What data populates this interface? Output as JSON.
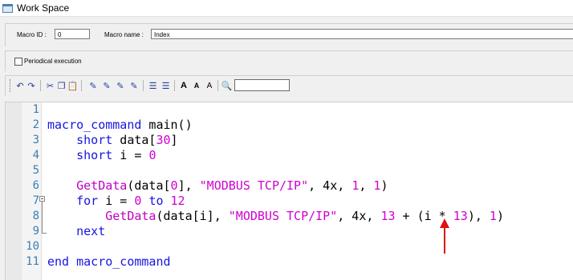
{
  "window": {
    "title": "Work Space"
  },
  "macro": {
    "id_label": "Macro ID :",
    "id_value": "0",
    "name_label": "Macro name :",
    "name_value": "Index"
  },
  "options": {
    "periodical_label": "Periodical execution",
    "periodical_checked": false
  },
  "toolbar": {
    "font_increase": "A",
    "font_decrease": "A",
    "font_normal": "A",
    "search_value": ""
  },
  "editor": {
    "lines": [
      {
        "n": "1",
        "tokens": []
      },
      {
        "n": "2",
        "tokens": [
          [
            "kw",
            "macro_command"
          ],
          [
            "pl",
            " main()"
          ]
        ]
      },
      {
        "n": "3",
        "tokens": [
          [
            "pl",
            "    "
          ],
          [
            "kw",
            "short"
          ],
          [
            "pl",
            " data["
          ],
          [
            "num",
            "30"
          ],
          [
            "pl",
            "]"
          ]
        ]
      },
      {
        "n": "4",
        "tokens": [
          [
            "pl",
            "    "
          ],
          [
            "kw",
            "short"
          ],
          [
            "pl",
            " i = "
          ],
          [
            "num",
            "0"
          ]
        ]
      },
      {
        "n": "5",
        "tokens": []
      },
      {
        "n": "6",
        "tokens": [
          [
            "pl",
            "    "
          ],
          [
            "fn",
            "GetData"
          ],
          [
            "pl",
            "(data["
          ],
          [
            "num",
            "0"
          ],
          [
            "pl",
            "], "
          ],
          [
            "str",
            "\"MODBUS TCP/IP\""
          ],
          [
            "pl",
            ", 4x, "
          ],
          [
            "num",
            "1"
          ],
          [
            "pl",
            ", "
          ],
          [
            "num",
            "1"
          ],
          [
            "pl",
            ")"
          ]
        ]
      },
      {
        "n": "7",
        "tokens": [
          [
            "pl",
            "    "
          ],
          [
            "kw",
            "for"
          ],
          [
            "pl",
            " i = "
          ],
          [
            "num",
            "0"
          ],
          [
            "pl",
            " "
          ],
          [
            "kw",
            "to"
          ],
          [
            "pl",
            " "
          ],
          [
            "num",
            "12"
          ]
        ]
      },
      {
        "n": "8",
        "tokens": [
          [
            "pl",
            "        "
          ],
          [
            "fn",
            "GetData"
          ],
          [
            "pl",
            "(data[i], "
          ],
          [
            "str",
            "\"MODBUS TCP/IP\""
          ],
          [
            "pl",
            ", 4x, "
          ],
          [
            "num",
            "13"
          ],
          [
            "pl",
            " + (i * "
          ],
          [
            "num",
            "13"
          ],
          [
            "pl",
            "), "
          ],
          [
            "num",
            "1"
          ],
          [
            "pl",
            ")"
          ]
        ]
      },
      {
        "n": "9",
        "tokens": [
          [
            "pl",
            "    "
          ],
          [
            "kw",
            "next"
          ]
        ]
      },
      {
        "n": "10",
        "tokens": []
      },
      {
        "n": "11",
        "tokens": [
          [
            "kw",
            "end macro_command"
          ]
        ]
      }
    ]
  },
  "colors": {
    "keyword": "#1515e0",
    "function": "#c000c0",
    "number_string": "#d000d0",
    "annotation_arrow": "#e01010"
  }
}
